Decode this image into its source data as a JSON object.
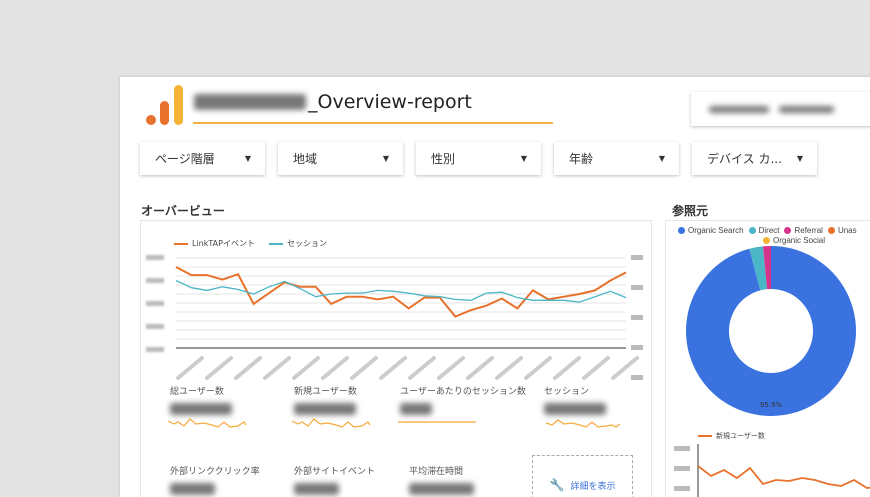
{
  "header": {
    "title_suffix": "_Overview-report",
    "accent": "#f1b143"
  },
  "filters": [
    {
      "label": "ページ階層"
    },
    {
      "label": "地域"
    },
    {
      "label": "性別"
    },
    {
      "label": "年齢"
    },
    {
      "label": "デバイス カ..."
    }
  ],
  "overview": {
    "heading": "オーバービュー"
  },
  "referral": {
    "heading": "参照元"
  },
  "chart_data": [
    {
      "type": "line",
      "series": [
        {
          "name": "LinkTAPイベント",
          "color": "#e8712b",
          "values": [
            90,
            81,
            81,
            76,
            82,
            49,
            61,
            73,
            68,
            68,
            49,
            57,
            57,
            54,
            57,
            44,
            56,
            56,
            35,
            42,
            47,
            55,
            44,
            64,
            54,
            57,
            60,
            64,
            75,
            84
          ]
        },
        {
          "name": "セッション",
          "color": "#4bb6c8",
          "values": [
            75,
            67,
            64,
            68,
            65,
            60,
            68,
            74,
            66,
            57,
            60,
            61,
            61,
            64,
            63,
            61,
            58,
            57,
            54,
            53,
            61,
            62,
            56,
            53,
            53,
            53,
            51,
            57,
            63,
            56
          ]
        }
      ],
      "grid": true,
      "legend": "top-left"
    },
    {
      "type": "pie",
      "donut": true,
      "legend": "top",
      "slices": [
        {
          "name": "Organic Search",
          "value": 95.9,
          "color": "#3a73e0",
          "label": "95.9%"
        },
        {
          "name": "Direct",
          "value": 2.6,
          "color": "#4bb6c8"
        },
        {
          "name": "Referral",
          "value": 1.5,
          "color": "#d6338a"
        },
        {
          "name": "Unas",
          "value": 0,
          "color": "#e8712b"
        },
        {
          "name": "Organic Social",
          "value": 0,
          "color": "#f5b335"
        }
      ]
    },
    {
      "type": "line",
      "series": [
        {
          "name": "新規ユーザー数",
          "color": "#e8712b",
          "values": [
            80,
            70,
            76,
            68,
            78,
            62,
            66,
            65,
            68,
            66,
            62,
            60,
            66,
            58,
            60,
            59
          ]
        }
      ]
    }
  ],
  "metrics": [
    {
      "label": "総ユーザー数"
    },
    {
      "label": "新規ユーザー数"
    },
    {
      "label": "ユーザーあたりのセッション数"
    },
    {
      "label": "セッション"
    },
    {
      "label": "外部リンククリック率"
    },
    {
      "label": "外部サイトイベント"
    },
    {
      "label": "平均滞在時間"
    }
  ],
  "details_link": "詳細を表示"
}
